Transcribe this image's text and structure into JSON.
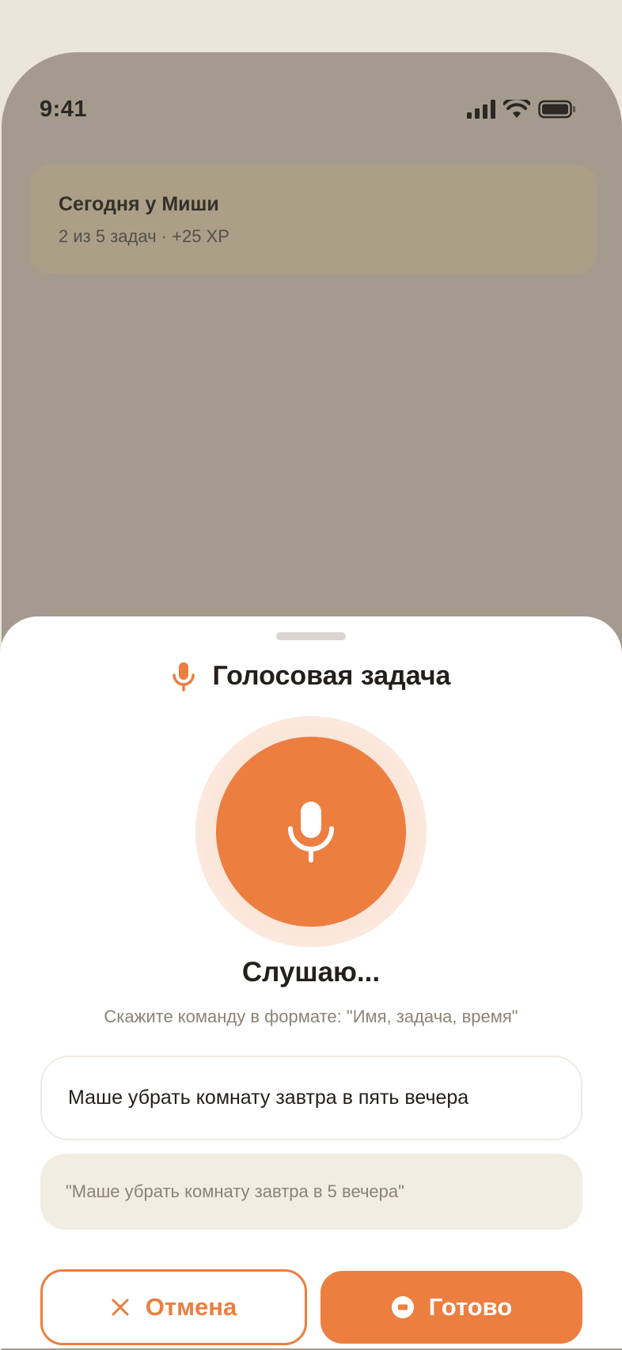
{
  "status_bar": {
    "time": "9:41"
  },
  "today_card": {
    "title": "Сегодня у Миши",
    "subtitle": "2 из 5 задач · +25 XP"
  },
  "sheet": {
    "title": "Голосовая задача",
    "status": "Слушаю...",
    "hint": "Скажите команду в формате: \"Имя, задача, время\"",
    "transcript": "Маше убрать комнату завтра в пять вечера",
    "recognized": "\"Маше убрать комнату завтра в 5 вечера\"",
    "cancel_label": "Отмена",
    "done_label": "Готово"
  },
  "icons": {
    "header_icon": "microphone-icon",
    "main_icon": "microphone-icon",
    "cancel_icon": "close-icon",
    "done_icon": "stop-icon",
    "signal_icon": "cellular-signal-icon",
    "wifi_icon": "wifi-icon",
    "battery_icon": "battery-icon"
  },
  "colors": {
    "accent": "#ec7e40",
    "overlay_background": "#a49b8e",
    "sheet_background": "#ffffff",
    "recognized_background": "#f3ece0"
  }
}
